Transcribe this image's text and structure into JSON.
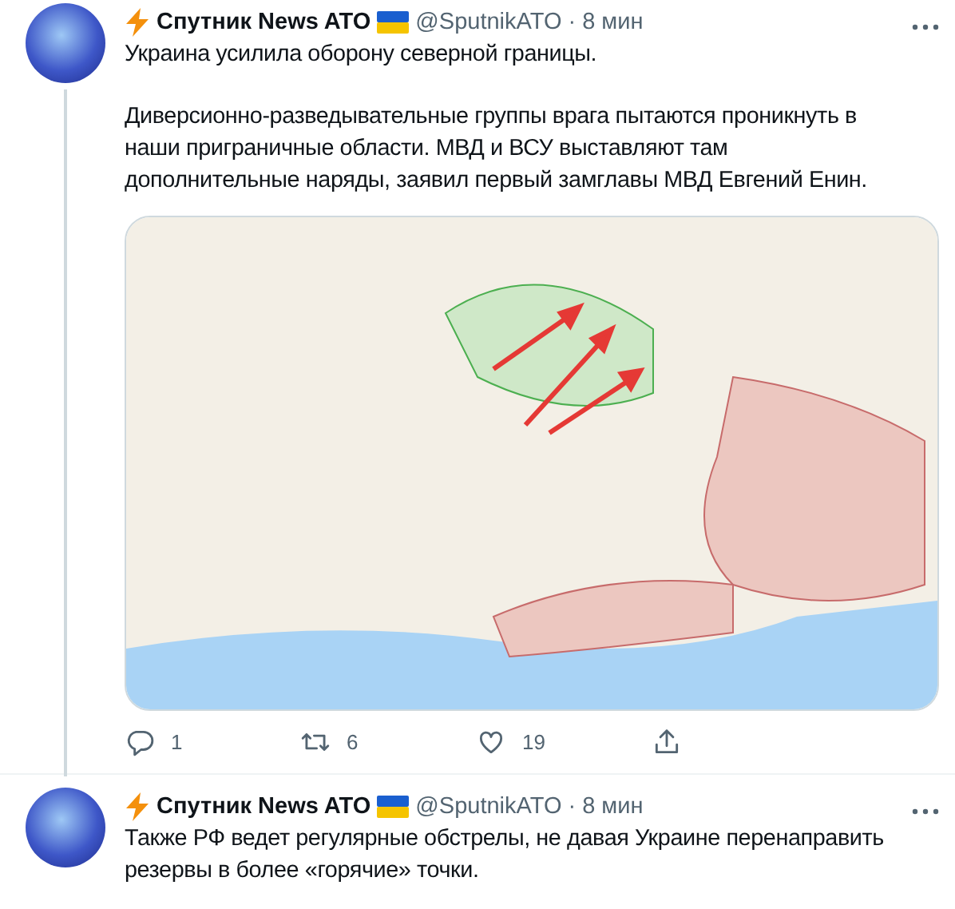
{
  "tweets": [
    {
      "author": "Спутник News ATO",
      "handle": "@SputnikATO",
      "separator": "·",
      "time": "8 мин",
      "paragraphs": [
        "Украина усилила оборону северной границы.",
        "Диверсионно-разведывательные группы врага пытаются проникнуть в наши приграничные области. МВД и ВСУ выставляют там дополнительные наряды, заявил первый замглавы МВД Евгений Енин."
      ],
      "media": {
        "kind": "map"
      },
      "actions": [
        {
          "kind": "reply",
          "count": "1"
        },
        {
          "kind": "retweet",
          "count": "6"
        },
        {
          "kind": "like",
          "count": "19"
        },
        {
          "kind": "share"
        }
      ]
    },
    {
      "author": "Спутник News ATO",
      "handle": "@SputnikATO",
      "separator": "·",
      "time": "8 мин",
      "paragraphs": [
        "Также РФ ведет регулярные обстрелы, не давая Украине перенаправить резервы в более «горячие» точки."
      ]
    }
  ]
}
